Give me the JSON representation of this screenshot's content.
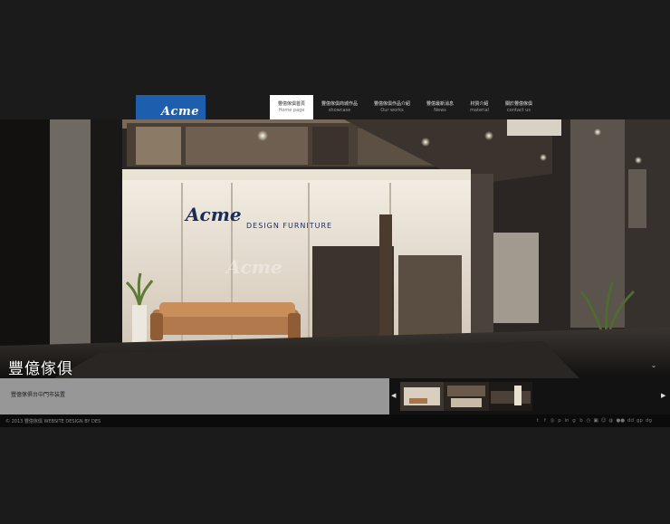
{
  "logo": {
    "text": "Acme"
  },
  "nav": [
    {
      "zh": "豐億傢俱首頁",
      "en": "Home page",
      "active": true
    },
    {
      "zh": "豐億傢俱商城作品",
      "en": "showcase"
    },
    {
      "zh": "豐億傢俱作品介紹",
      "en": "Our works"
    },
    {
      "zh": "豐億最新消息",
      "en": "News"
    },
    {
      "zh": "材質介紹",
      "en": "material"
    },
    {
      "zh": "關於豐億傢俱",
      "en": "contact us"
    }
  ],
  "hero": {
    "title": "豐億傢俱",
    "storefront_sign_brand": "Acme",
    "storefront_sign_sub": "DESIGN FURNITURE",
    "glass_brand": "Acme",
    "scroll_icon": "chevron-double-down-icon"
  },
  "strip": {
    "caption": "豐億傢俱台中門市装置",
    "prev_icon": "caret-left-icon",
    "next_icon": "caret-right-icon"
  },
  "footer": {
    "copyright": "© 2013 豐億傢俱 WEBSITE DESIGN BY DES",
    "social": [
      "t",
      "f",
      "◎",
      "p",
      "in",
      "g",
      "b",
      "◷",
      "▣",
      "☺",
      "◍",
      "●●",
      "dd",
      "gp",
      "dg"
    ]
  }
}
